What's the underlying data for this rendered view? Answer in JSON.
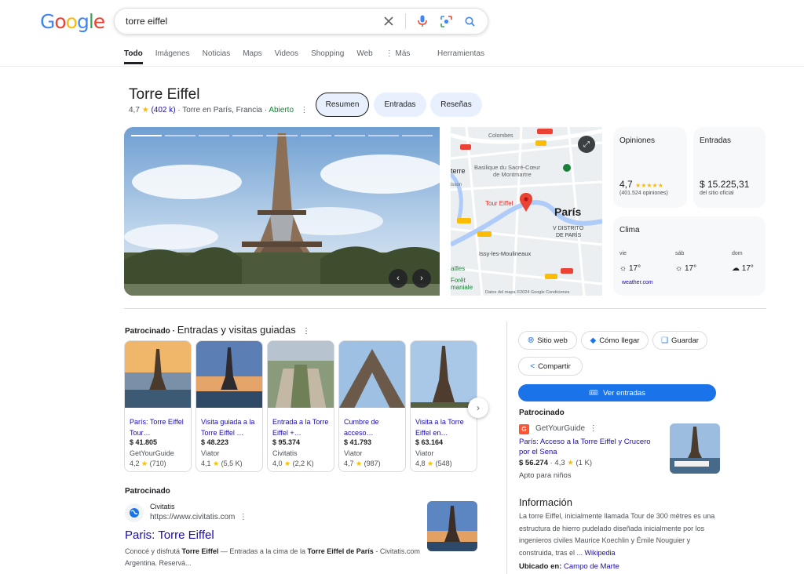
{
  "colors": {
    "accent": "#1a73e8",
    "link": "#1a0dab",
    "open_green": "#188038",
    "star": "#fbbc04"
  },
  "search": {
    "query": "torre eiffel"
  },
  "tabs": [
    "Todo",
    "Imágenes",
    "Noticias",
    "Maps",
    "Videos",
    "Shopping",
    "Web",
    "⋮ Más"
  ],
  "tools_label": "Herramientas",
  "entity": {
    "title": "Torre Eiffel",
    "rating": "4,7",
    "reviews": "(402 k)",
    "type": "· Torre en París, Francia ·",
    "status": "Abierto",
    "chips": [
      "Resumen",
      "Entradas",
      "Reseñas"
    ]
  },
  "map": {
    "labels": {
      "paris": "París",
      "district": "V DISTRITO\nDE PARÍS",
      "pin": "Tour Eiffel",
      "sacre": "Basilique du Sacré-Cœur\nde Montmartre",
      "colombes": "Colombes",
      "issy": "Issy-les-Moulineaux"
    },
    "footer": "Datos del mapa ©2024 Google   Condiciones"
  },
  "cards": {
    "opiniones": {
      "label": "Opiniones",
      "value": "4,7",
      "count": "(401.524 opiniones)"
    },
    "entradas": {
      "label": "Entradas",
      "value": "$ 15.225,31",
      "source": "del sitio oficial"
    },
    "clima": {
      "label": "Clima",
      "days": [
        {
          "day": "vie",
          "temp": "17°"
        },
        {
          "day": "sáb",
          "temp": "17°"
        },
        {
          "day": "dom",
          "temp": "17°"
        }
      ],
      "source": "weather.com"
    }
  },
  "tours": {
    "sponsored": "Patrocinado ·",
    "title": "Entradas y visitas guiadas",
    "items": [
      {
        "title": "París: Torre Eiffel Tour…",
        "price": "$ 41.805",
        "provider": "GetYourGuide",
        "rating": "4,2",
        "count": "(710)"
      },
      {
        "title": "Visita guiada a la Torre Eiffel …",
        "price": "$ 48.223",
        "provider": "Viator",
        "rating": "4,1",
        "count": "(5,5 K)"
      },
      {
        "title": "Entrada a la Torre Eiffel +…",
        "price": "$ 95.374",
        "provider": "Civitatis",
        "rating": "4,0",
        "count": "(2,2 K)"
      },
      {
        "title": "Cumbre de acceso…",
        "price": "$ 41.793",
        "provider": "Viator",
        "rating": "4,7",
        "count": "(987)"
      },
      {
        "title": "Visita a la Torre Eiffel en…",
        "price": "$ 63.164",
        "provider": "Viator",
        "rating": "4,8",
        "count": "(548)"
      }
    ]
  },
  "ad": {
    "label": "Patrocinado",
    "site_name": "Civitatis",
    "site_url": "https://www.civitatis.com",
    "title": "Paris: Torre Eiffel",
    "desc_1": "Conocé y disfrutá ",
    "desc_b1": "Torre Eiffel",
    "desc_2": " — Entradas a la cima de la ",
    "desc_b2": "Torre Eiffel de París",
    "desc_3": " - Civitatis.com Argentina. Reservá..."
  },
  "actions": {
    "website": "Sitio web",
    "directions": "Cómo llegar",
    "save": "Guardar",
    "share": "Compartir",
    "tickets": "Ver entradas"
  },
  "sponsored_right": {
    "label": "Patrocinado",
    "provider": "GetYourGuide",
    "title": "París: Acceso a la Torre Eiffel y Crucero por el Sena",
    "price": "$ 56.274",
    "rating": "· 4,3",
    "count": "(1 K)",
    "note": "Apto para niños"
  },
  "info": {
    "title": "Información",
    "text": "La torre Eiffel, inicialmente llamada Tour de 300 mètres es una estructura de hierro pudelado diseñada inicialmente por los ingenieros civiles Maurice Koechlin y Émile Nouguier y construida, tras el ... ",
    "wiki": "Wikipedia",
    "loc_label": "Ubicado en:",
    "loc_value": "Campo de Marte"
  }
}
